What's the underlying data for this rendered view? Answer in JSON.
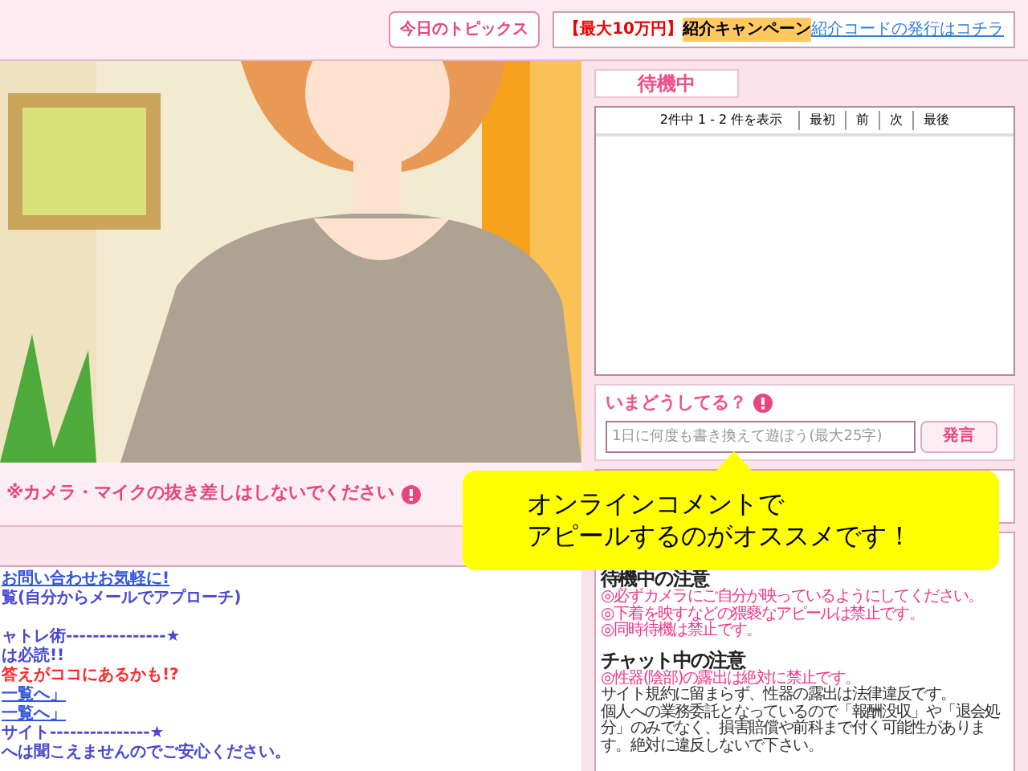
{
  "header": {
    "topics_button": "今日のトピックス",
    "banner": {
      "prefix": "【最大10万円】",
      "highlight": "紹介キャンペーン",
      "link": "紹介コードの発行はコチラ"
    }
  },
  "camera_notice": "※カメラ・マイクの抜き差しはしないでください",
  "info_groups": [
    [
      {
        "text": "お問い合わせお気軽に!",
        "kind": "link"
      },
      {
        "text": "覧(自分からメールでアプローチ)",
        "kind": "text"
      }
    ],
    [
      {
        "text": "ャトレ術---------------★",
        "kind": "text"
      },
      {
        "text": "は必読!!",
        "kind": "text"
      },
      {
        "text": "答えがココにあるかも!?",
        "kind": "alert"
      },
      {
        "text": "一覧へ」",
        "kind": "link"
      },
      {
        "text": "一覧へ」",
        "kind": "link"
      },
      {
        "text": "サイト---------------★",
        "kind": "text"
      },
      {
        "text": "へは聞こえませんのでご安心ください。",
        "kind": "text"
      }
    ]
  ],
  "status_label": "待機中",
  "pager": {
    "summary": "2件中 1 - 2 件を表示",
    "links": [
      "最初",
      "前",
      "次",
      "最後"
    ]
  },
  "status_post": {
    "title": "いまどうしてる？",
    "placeholder": "1日に何度も書き換えて遊ぼう(最大25字)",
    "button": "発言"
  },
  "callout": [
    "オンラインコメントで",
    "アピールするのがオススメです！"
  ],
  "notes": [
    {
      "title": "待機中の注意",
      "items": [
        {
          "text": "◎必ずカメラにご自分が映っているようにしてください。",
          "kind": "warning"
        },
        {
          "text": "◎下着を映すなどの猥褻なアピールは禁止です。",
          "kind": "warning"
        },
        {
          "text": "◎同時待機は禁止です。",
          "kind": "warning"
        }
      ]
    },
    {
      "title": "チャット中の注意",
      "items": [
        {
          "text": "◎性器(陰部)の露出は絶対に禁止です。",
          "kind": "warning"
        },
        {
          "text": "サイト規約に留まらず、性器の露出は法律違反です。",
          "kind": "plain"
        },
        {
          "text": "個人への業務委託となっているので「報酬没収」や「退会処分」のみでなく、損害賠償や前科まで付く可能性があります。絶対に違反しないで下さい。",
          "kind": "plain"
        }
      ]
    }
  ]
}
